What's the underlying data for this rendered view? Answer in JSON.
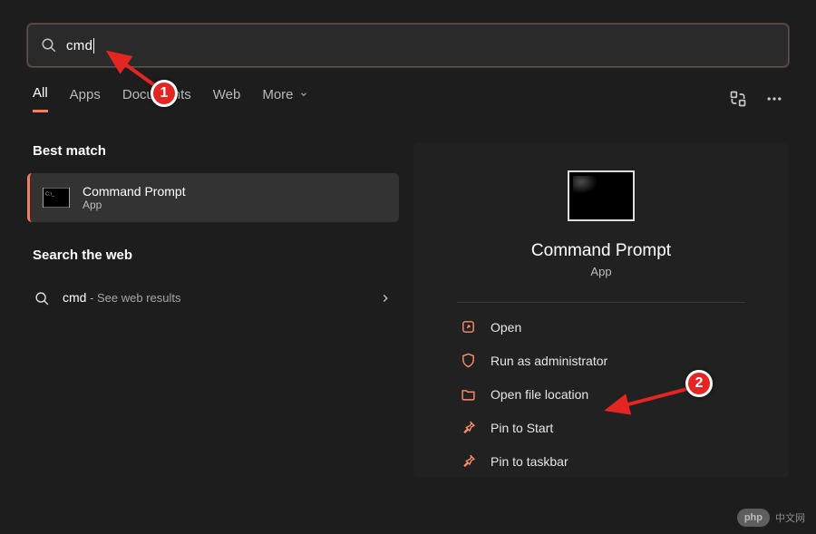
{
  "search": {
    "query": "cmd"
  },
  "tabs": {
    "items": [
      {
        "label": "All"
      },
      {
        "label": "Apps"
      },
      {
        "label": "Documents"
      },
      {
        "label": "Web"
      },
      {
        "label": "More"
      }
    ]
  },
  "left": {
    "section1_title": "Best match",
    "result": {
      "title": "Command Prompt",
      "subtitle": "App"
    },
    "section2_title": "Search the web",
    "web": {
      "term": "cmd",
      "suffix": " - See web results"
    }
  },
  "right": {
    "title": "Command Prompt",
    "subtitle": "App",
    "actions": [
      {
        "label": "Open"
      },
      {
        "label": "Run as administrator"
      },
      {
        "label": "Open file location"
      },
      {
        "label": "Pin to Start"
      },
      {
        "label": "Pin to taskbar"
      }
    ]
  },
  "annotations": {
    "badge1": "1",
    "badge2": "2"
  },
  "watermark": {
    "pill": "php",
    "text": "中文网"
  }
}
